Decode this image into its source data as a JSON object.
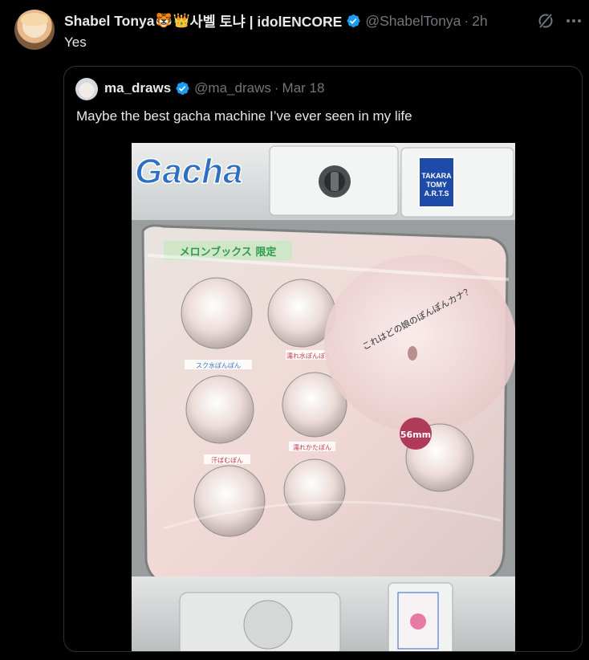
{
  "post": {
    "display_name": "Shabel Tonya",
    "name_suffix": "사벨 토냐 | idolENCORE",
    "emoji_1": "🐯",
    "emoji_2": "👑",
    "handle": "@ShabelTonya",
    "separator": "·",
    "time": "2h",
    "text": "Yes"
  },
  "quoted_post": {
    "display_name": "ma_draws",
    "handle": "@ma_draws",
    "separator": "·",
    "time": "Mar 18",
    "text": "Maybe the best gacha machine I’ve ever seen in my life"
  },
  "photo": {
    "brand_logo": "Gacha",
    "maker_label": "TAKARA TOMY A.R.T.S",
    "panel_title": "メロンブックス 限定",
    "panel_caption": "これはどの娘のぽんぽんカナ？",
    "size_badge": "56mm",
    "thumb_labels": [
      "スク水ぽんぽん",
      "濡れ水ぽんぽん",
      "汗ばむぽん",
      "濡れかたぽん"
    ]
  },
  "icons": {
    "verified": "verified-badge-icon",
    "grok": "grok-icon",
    "more": "more-options-icon"
  },
  "colors": {
    "background": "#000000",
    "text_primary": "#e7e9ea",
    "text_secondary": "#71767b",
    "border": "#2f3336",
    "verified_blue": "#1d9bf0"
  }
}
